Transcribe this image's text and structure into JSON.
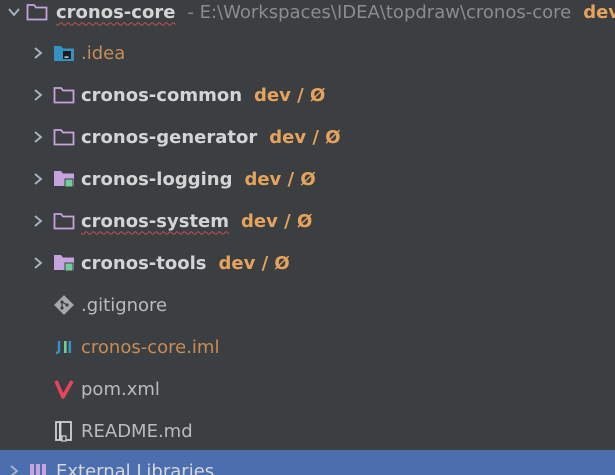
{
  "root": {
    "name": "cronos-core",
    "path": " - E:\\Workspaces\\IDEA\\topdraw\\cronos-core",
    "vcs": "dev / Ø"
  },
  "items": [
    {
      "label": ".idea",
      "vcs": ""
    },
    {
      "label": "cronos-common",
      "vcs": "dev / Ø"
    },
    {
      "label": "cronos-generator",
      "vcs": "dev / Ø"
    },
    {
      "label": "cronos-logging",
      "vcs": "dev / Ø"
    },
    {
      "label": "cronos-system",
      "vcs": "dev / Ø"
    },
    {
      "label": "cronos-tools",
      "vcs": "dev / Ø"
    },
    {
      "label": ".gitignore",
      "vcs": ""
    },
    {
      "label": "cronos-core.iml",
      "vcs": ""
    },
    {
      "label": "pom.xml",
      "vcs": ""
    },
    {
      "label": "README.md",
      "vcs": ""
    },
    {
      "label": "External Libraries",
      "vcs": ""
    }
  ],
  "colors": {
    "background": "#3c3f41",
    "selection": "#4b6eaf",
    "vcs_branch": "#e5a35d",
    "folder_outline": "#c8a2df",
    "module_badge": "#6fcf97"
  },
  "icons": {
    "root": "folder-open-icon",
    "idea": "idea-folder-icon",
    "folder": "folder-icon",
    "module": "module-folder-icon",
    "git": "git-icon",
    "iml": "iml-file-icon",
    "maven": "maven-icon",
    "markdown": "markdown-file-icon",
    "libraries": "library-icon"
  }
}
